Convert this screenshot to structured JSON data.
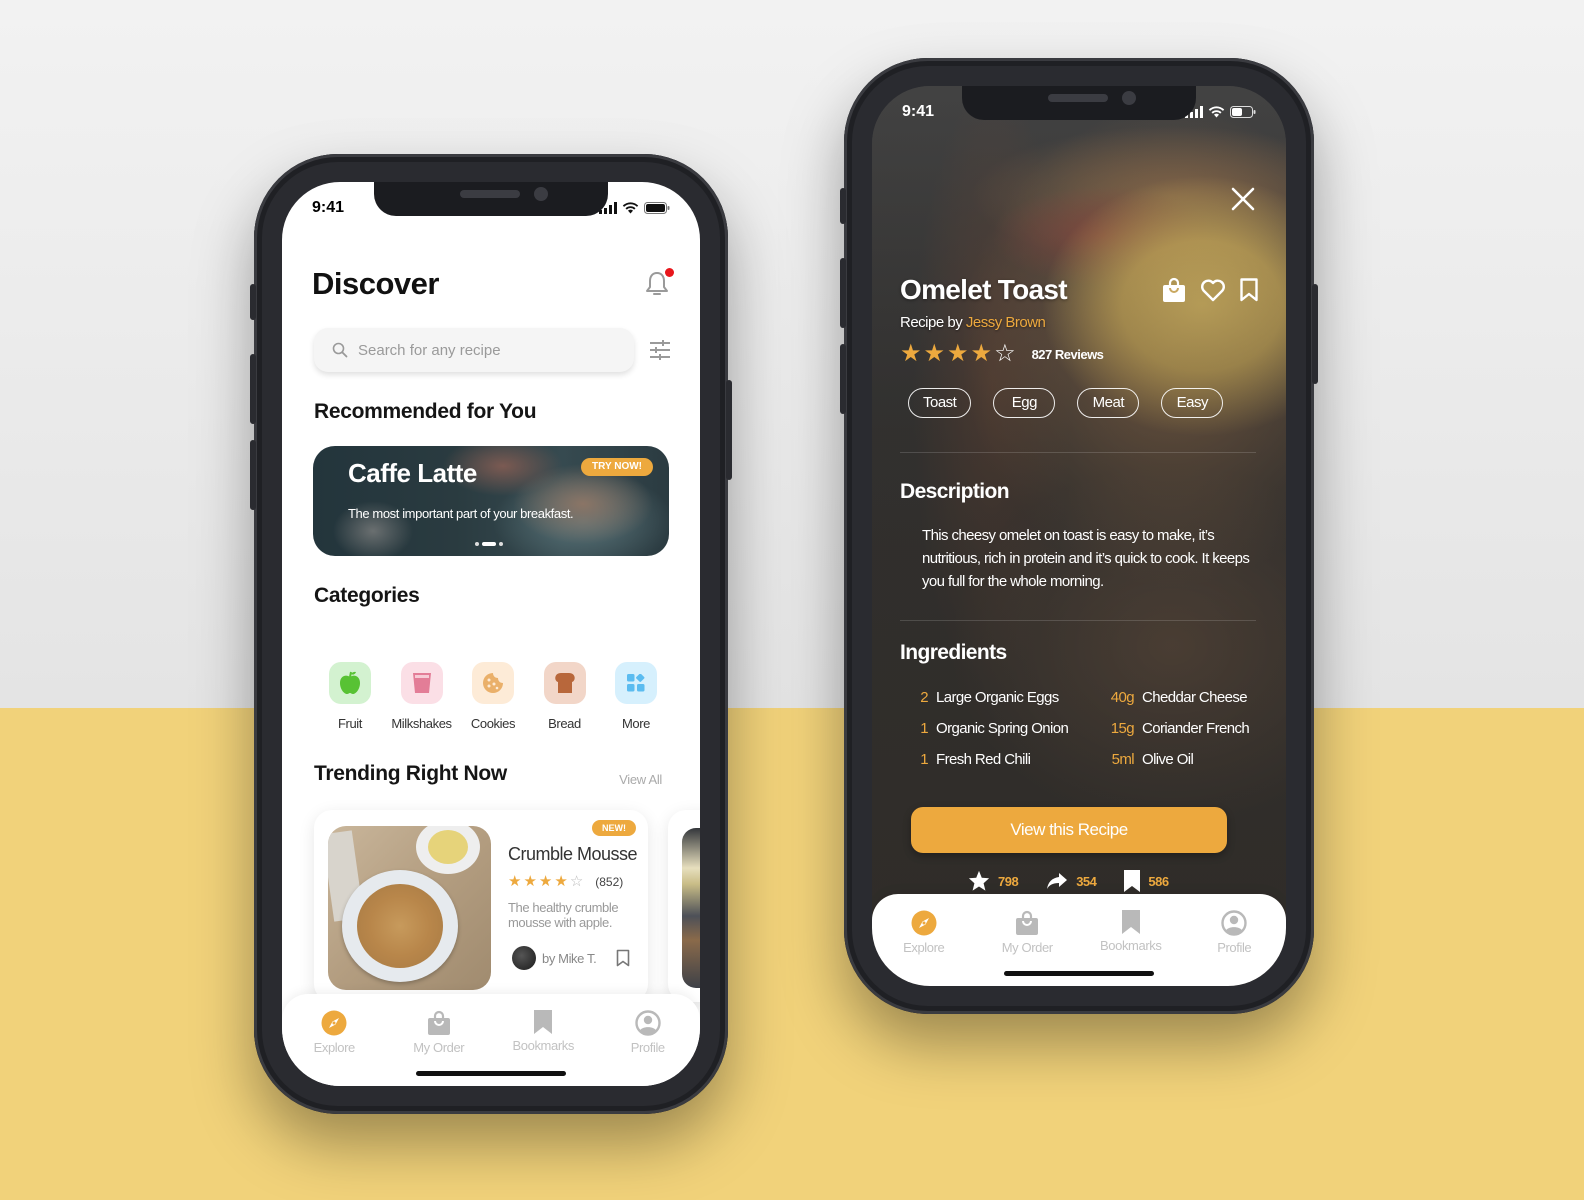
{
  "colors": {
    "accent": "#eda93e",
    "notification": "#e8161b",
    "background_top": "#e6e6e6",
    "background_bottom": "#f1d27a",
    "tab_inactive": "#b9b9b9"
  },
  "discover_screen": {
    "status_bar": {
      "time": "9:41",
      "icons": [
        "signal-icon",
        "wifi-icon",
        "battery-icon"
      ]
    },
    "header": {
      "title": "Discover",
      "notification_icon": "bell-icon",
      "has_notification": true
    },
    "search": {
      "placeholder": "Search for any recipe",
      "value": "",
      "filter_icon": "sliders-icon"
    },
    "recommended": {
      "title": "Recommended for You",
      "banner": {
        "title": "Caffe Latte",
        "subtitle": "The most important part of your breakfast.",
        "badge": "TRY NOW!",
        "slides": 3,
        "active_slide": 2
      }
    },
    "categories": {
      "title": "Categories",
      "items": [
        {
          "label": "Fruit",
          "icon": "apple-icon",
          "bg": "#d3f2d0",
          "fg": "#58c234"
        },
        {
          "label": "Milkshakes",
          "icon": "glass-icon",
          "bg": "#fbdfe6",
          "fg": "#e37d97"
        },
        {
          "label": "Cookies",
          "icon": "cookie-icon",
          "bg": "#fdebd7",
          "fg": "#eab06a"
        },
        {
          "label": "Bread",
          "icon": "bread-icon",
          "bg": "#f2d6c8",
          "fg": "#b8673b"
        },
        {
          "label": "More",
          "icon": "grid-icon",
          "bg": "#d6f0fd",
          "fg": "#5bbcf0"
        }
      ]
    },
    "trending": {
      "title": "Trending Right Now",
      "view_all": "View All",
      "cards": [
        {
          "title": "Crumble Mousse",
          "badge": "NEW!",
          "rating": 4,
          "rating_max": 5,
          "rating_count": "(852)",
          "description": "The healthy crumble mousse with apple.",
          "author": "by Mike T."
        }
      ]
    },
    "tab_bar": {
      "items": [
        {
          "label": "Explore",
          "icon": "compass-icon",
          "active": true
        },
        {
          "label": "My Order",
          "icon": "shopping-bag-icon",
          "active": false
        },
        {
          "label": "Bookmarks",
          "icon": "bookmark-icon",
          "active": false
        },
        {
          "label": "Profile",
          "icon": "profile-icon",
          "active": false
        }
      ]
    }
  },
  "recipe_screen": {
    "status_bar": {
      "time": "9:41",
      "icons": [
        "signal-icon",
        "wifi-icon",
        "battery-icon"
      ]
    },
    "close_icon": "close-icon",
    "title": "Omelet Toast",
    "recipe_by_prefix": "Recipe by",
    "author": "Jessy Brown",
    "actions": [
      "shopping-bag-icon",
      "heart-icon",
      "bookmark-icon"
    ],
    "rating": 4,
    "rating_max": 5,
    "reviews": "827 Reviews",
    "tags": [
      "Toast",
      "Egg",
      "Meat",
      "Easy"
    ],
    "description_title": "Description",
    "description": "This cheesy omelet on toast is easy to make, it’s nutritious, rich in protein and it’s quick to cook. It keeps you full for the whole morning.",
    "ingredients_title": "Ingredients",
    "ingredients": [
      {
        "qty": "2",
        "name": "Large Organic Eggs"
      },
      {
        "qty": "40g",
        "name": "Cheddar Cheese"
      },
      {
        "qty": "1",
        "name": "Organic Spring Onion"
      },
      {
        "qty": "15g",
        "name": "Coriander French"
      },
      {
        "qty": "1",
        "name": "Fresh Red Chili"
      },
      {
        "qty": "5ml",
        "name": "Olive Oil"
      }
    ],
    "cta": "View this Recipe",
    "stats": [
      {
        "icon": "star-icon",
        "value": "798"
      },
      {
        "icon": "share-icon",
        "value": "354"
      },
      {
        "icon": "bookmark-icon",
        "value": "586"
      }
    ],
    "tab_bar": {
      "items": [
        {
          "label": "Explore",
          "icon": "compass-icon",
          "active": true
        },
        {
          "label": "My Order",
          "icon": "shopping-bag-icon",
          "active": false
        },
        {
          "label": "Bookmarks",
          "icon": "bookmark-icon",
          "active": false
        },
        {
          "label": "Profile",
          "icon": "profile-icon",
          "active": false
        }
      ]
    }
  }
}
